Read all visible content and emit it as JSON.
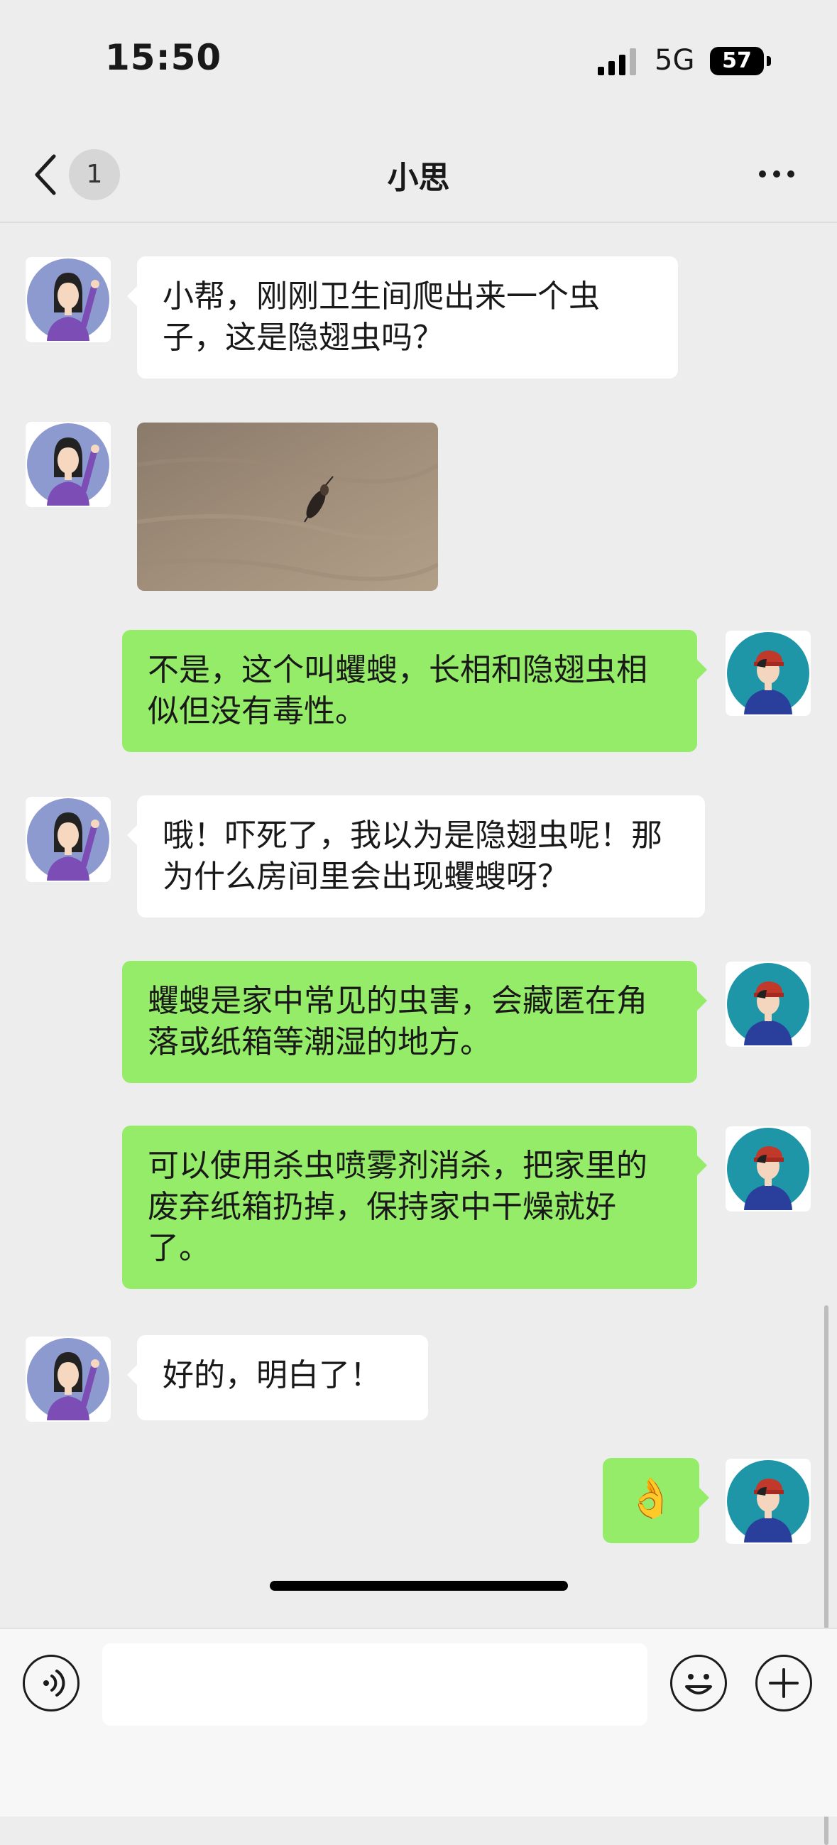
{
  "status_bar": {
    "time": "15:50",
    "network": "5G",
    "battery": "57"
  },
  "nav": {
    "unread_count": "1",
    "title": "小思"
  },
  "messages": [
    {
      "side": "left",
      "text": "小帮，刚刚卫生间爬出来一个虫子，这是隐翅虫吗？"
    },
    {
      "side": "left",
      "type": "image"
    },
    {
      "side": "right",
      "text": "不是，这个叫蠼螋，长相和隐翅虫相似但没有毒性。"
    },
    {
      "side": "left",
      "text": "哦！吓死了，我以为是隐翅虫呢！那为什么房间里会出现蠼螋呀？"
    },
    {
      "side": "right",
      "text": "蠼螋是家中常见的虫害，会藏匿在角落或纸箱等潮湿的地方。"
    },
    {
      "side": "right",
      "text": "可以使用杀虫喷雾剂消杀，把家里的废弃纸箱扔掉，保持家中干燥就好了。"
    },
    {
      "side": "left",
      "text": "好的，明白了！"
    },
    {
      "side": "right",
      "text": "👌"
    }
  ],
  "input": {
    "placeholder": ""
  },
  "colors": {
    "background": "#ededed",
    "my_bubble": "#95ec69",
    "their_bubble": "#ffffff"
  },
  "icons": [
    "back-arrow-icon",
    "more-icon",
    "voice-icon",
    "emoji-icon",
    "plus-icon"
  ]
}
